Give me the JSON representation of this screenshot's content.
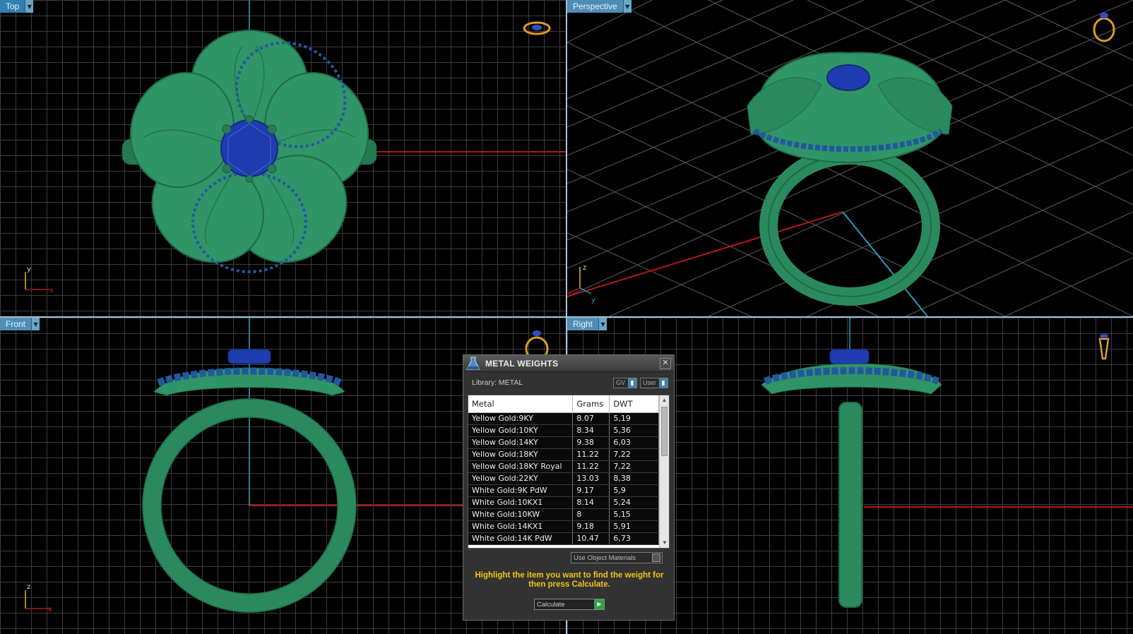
{
  "viewports": {
    "top": {
      "label": "Top"
    },
    "perspective": {
      "label": "Perspective"
    },
    "front": {
      "label": "Front"
    },
    "right": {
      "label": "Right"
    }
  },
  "axes": {
    "top": {
      "v": "y",
      "h": "x"
    },
    "perspective": {
      "z": "z",
      "x": "x",
      "y": "y"
    },
    "front": {
      "v": "z",
      "h": "x"
    }
  },
  "colors": {
    "metal": "#2d8f63",
    "gem": "#1f2fb8",
    "grid": "#3c3c3c",
    "x_axis": "#b01818",
    "y_axis": "#2a9ab8",
    "dialog_text": "#f2c418"
  },
  "dialog": {
    "title": "METAL WEIGHTS",
    "icon": "flask-icon",
    "close_icon": "close-icon",
    "library_label": "Library: METAL",
    "toggle_gv": "GV",
    "toggle_user": "User",
    "columns": [
      "Metal",
      "Grams",
      "DWT"
    ],
    "rows": [
      [
        "Yellow Gold:9KY",
        "8.07",
        "5,19"
      ],
      [
        "Yellow Gold:10KY",
        "8.34",
        "5,36"
      ],
      [
        "Yellow Gold:14KY",
        "9.38",
        "6,03"
      ],
      [
        "Yellow Gold:18KY",
        "11.22",
        "7,22"
      ],
      [
        "Yellow Gold:18KY Royal",
        "11.22",
        "7,22"
      ],
      [
        "Yellow Gold:22KY",
        "13.03",
        "8,38"
      ],
      [
        "White Gold:9K PdW",
        "9.17",
        "5,9"
      ],
      [
        "White Gold:10KX1",
        "8.14",
        "5,24"
      ],
      [
        "White Gold:10KW",
        "8",
        "5,15"
      ],
      [
        "White Gold:14KX1",
        "9.18",
        "5,91"
      ],
      [
        "White Gold:14K PdW",
        "10.47",
        "6,73"
      ]
    ],
    "use_object_materials": "Use Object Materials",
    "instruction": "Highlight the item you want to find the weight for then press Calculate.",
    "calculate_label": "Calculate"
  }
}
